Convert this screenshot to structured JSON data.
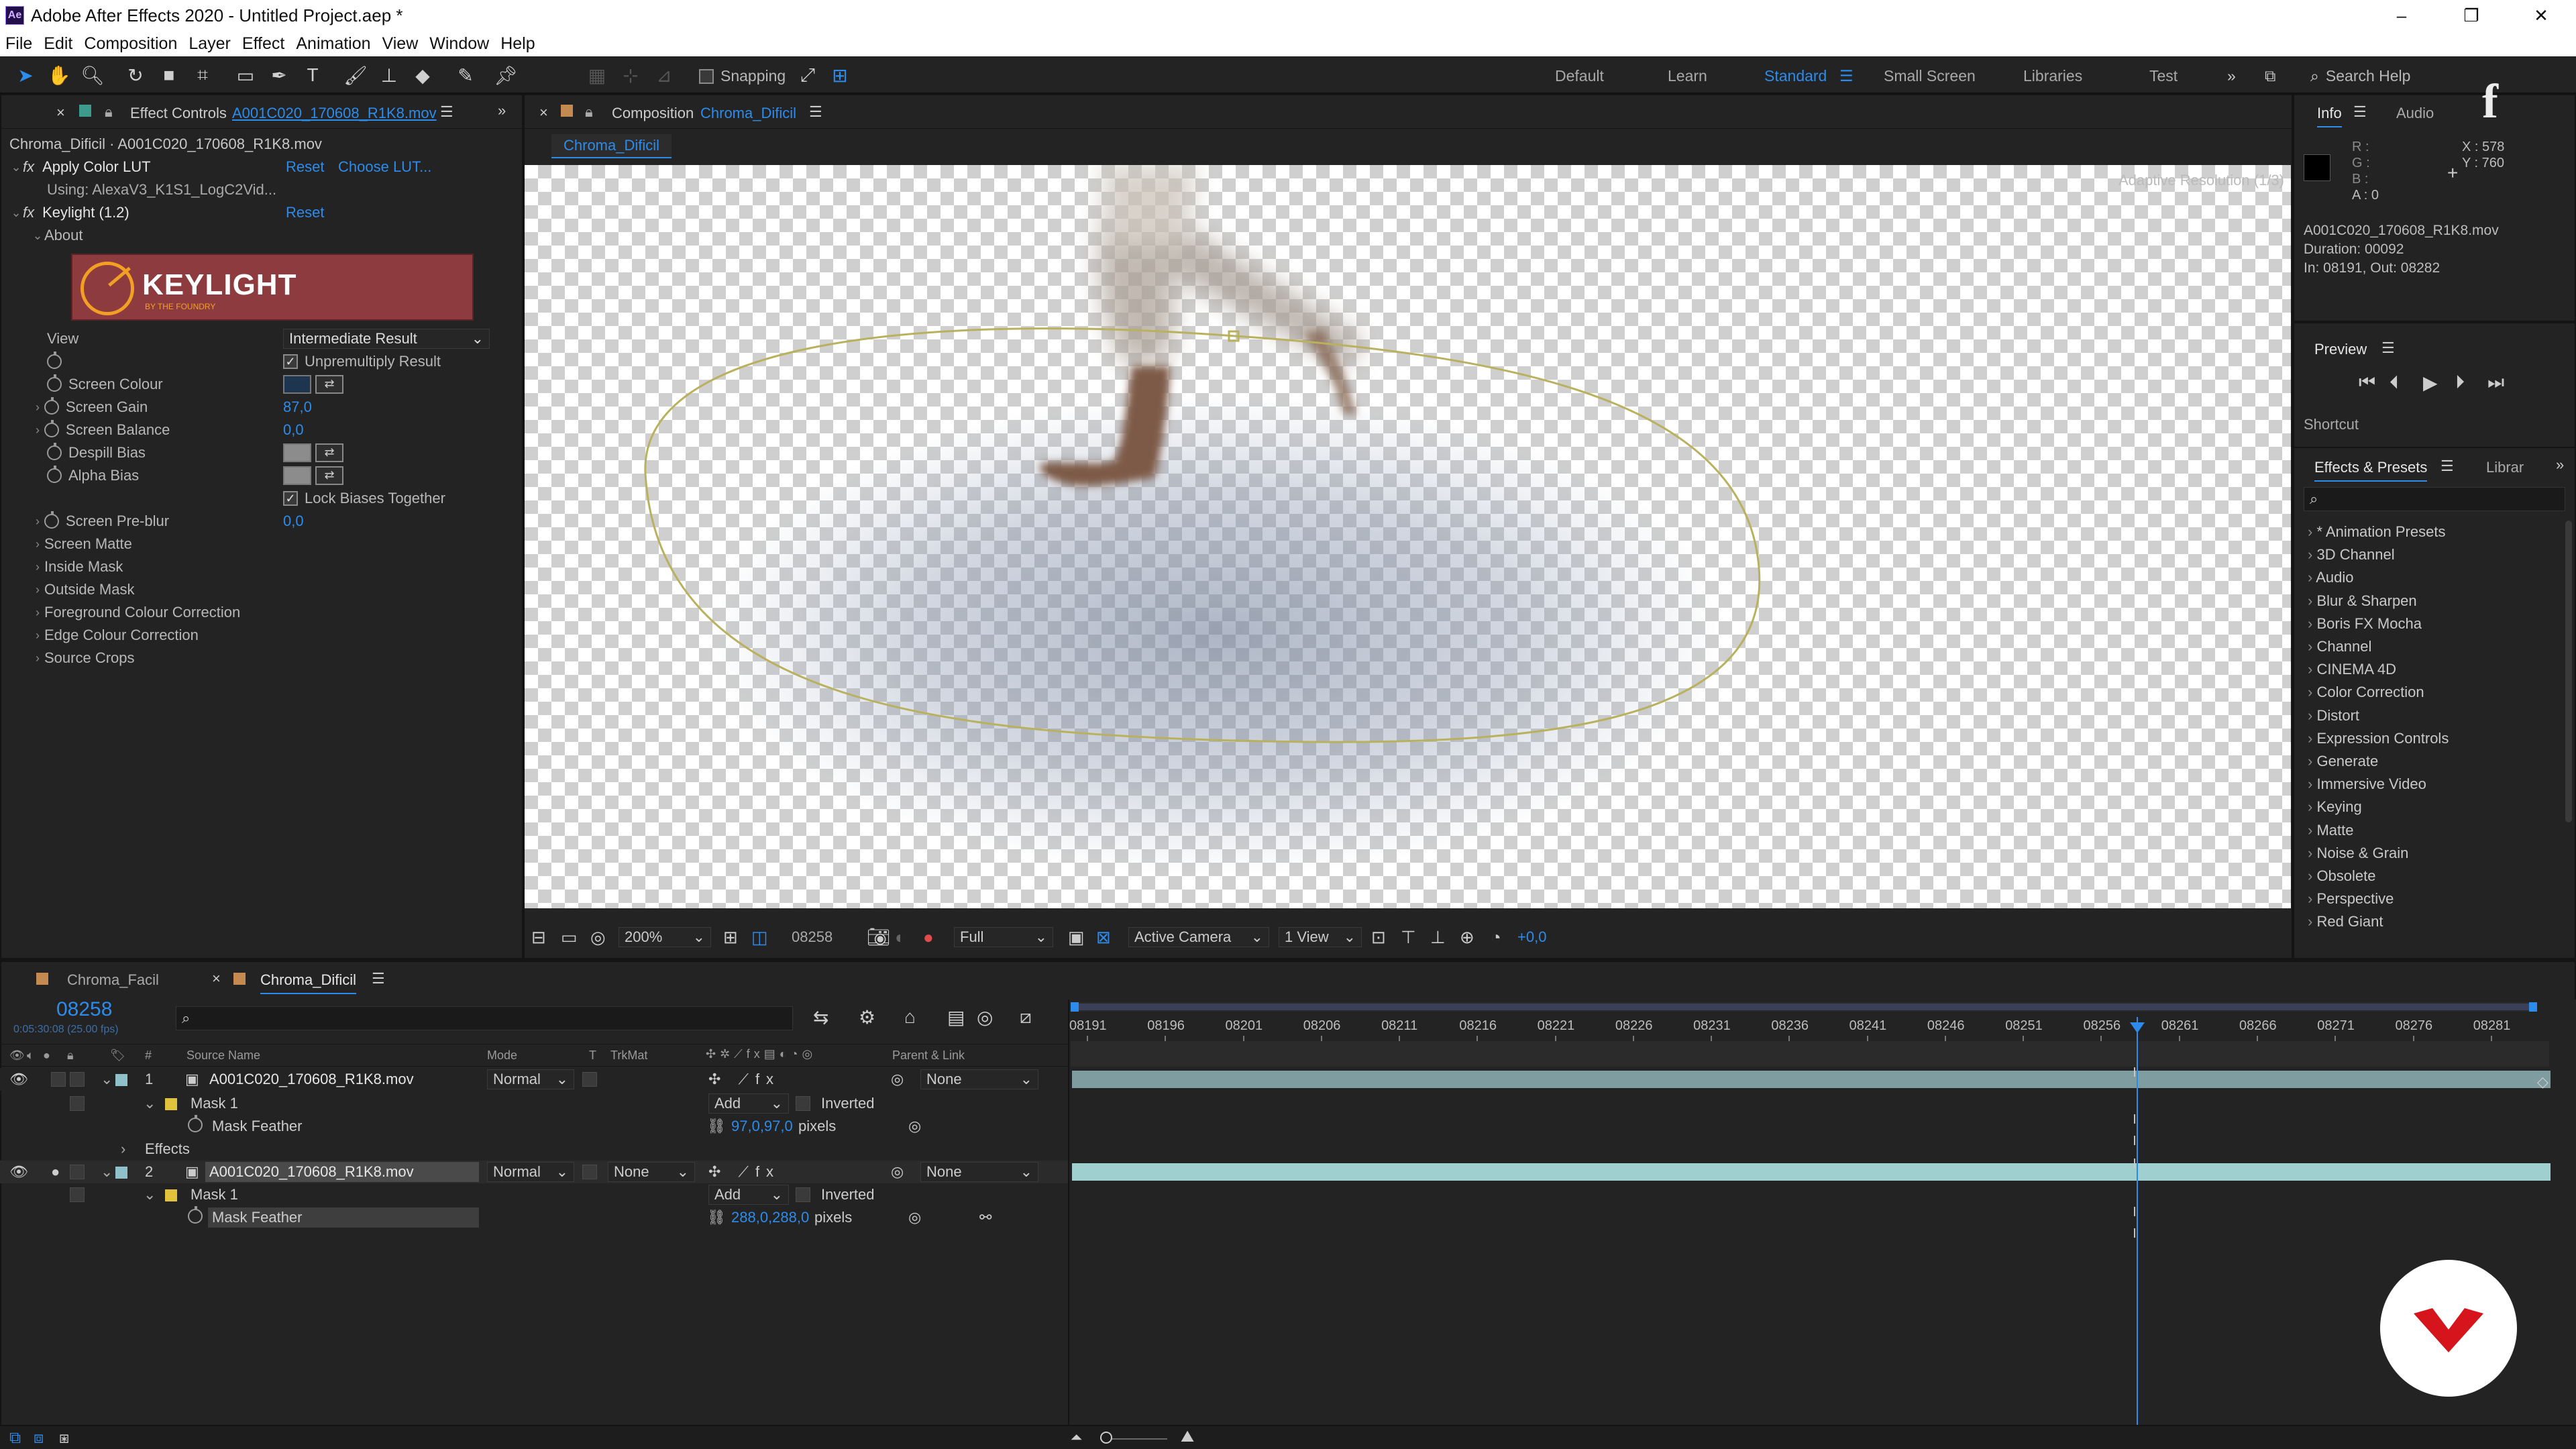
{
  "window": {
    "title": "Adobe After Effects 2020 - Untitled Project.aep *",
    "app_icon": "Ae",
    "controls": [
      "–",
      "❐",
      "✕"
    ]
  },
  "menu": [
    "File",
    "Edit",
    "Composition",
    "Layer",
    "Effect",
    "Animation",
    "View",
    "Window",
    "Help"
  ],
  "toolbar": {
    "snapping_label": "Snapping",
    "workspaces": [
      "Default",
      "Learn",
      "Standard",
      "Small Screen",
      "Libraries",
      "Test"
    ],
    "active_workspace": "Standard",
    "search_placeholder": "Search Help"
  },
  "effect_controls": {
    "tab_prefix": "Effect Controls",
    "tab_file": "A001C020_170608_R1K8.mov",
    "subtitle": "Chroma_Dificil · A001C020_170608_R1K8.mov",
    "apply_lut": {
      "name": "Apply Color LUT",
      "reset": "Reset",
      "choose": "Choose LUT...",
      "using": "Using: AlexaV3_K1S1_LogC2Vid..."
    },
    "keylight": {
      "name": "Keylight (1.2)",
      "reset": "Reset",
      "about": "About",
      "logo_text": "KEYLIGHT",
      "logo_sub": "BY THE FOUNDRY"
    },
    "view_label": "View",
    "view_value": "Intermediate Result",
    "unpremultiply": "Unpremultiply Result",
    "screen_colour": "Screen Colour",
    "screen_gain": {
      "label": "Screen Gain",
      "value": "87,0"
    },
    "screen_balance": {
      "label": "Screen Balance",
      "value": "0,0"
    },
    "despill_bias": "Despill Bias",
    "alpha_bias": "Alpha Bias",
    "lock_biases": "Lock Biases Together",
    "screen_preblur": {
      "label": "Screen Pre-blur",
      "value": "0,0"
    },
    "groups": [
      "Screen Matte",
      "Inside Mask",
      "Outside Mask",
      "Foreground Colour Correction",
      "Edge Colour Correction",
      "Source Crops"
    ],
    "colors": {
      "screen_colour": "#1e3550",
      "bias_swatch": "#8c8c8c"
    }
  },
  "composition": {
    "tab_prefix": "Composition",
    "tab_name": "Chroma_Dificil",
    "breadcrumb": "Chroma_Dificil",
    "resolution_note": "Adaptive Resolution (1/3)"
  },
  "viewer_bar": {
    "zoom": "200%",
    "timecode": "08258",
    "quality": "Full",
    "camera": "Active Camera",
    "views": "1 View",
    "exposure": "+0,0"
  },
  "info": {
    "tabs": [
      "Info",
      "Audio"
    ],
    "r": "R :",
    "g": "G :",
    "b": "B :",
    "a": "A : 0",
    "x": "X : 578",
    "y": "Y : 760",
    "file": "A001C020_170608_R1K8.mov",
    "duration": "Duration: 00092",
    "in_out": "In: 08191, Out: 08282"
  },
  "preview": {
    "title": "Preview",
    "shortcut": "Shortcut"
  },
  "effects_presets": {
    "tabs": [
      "Effects & Presets",
      "Librar"
    ],
    "search_placeholder": "",
    "items": [
      "* Animation Presets",
      "3D Channel",
      "Audio",
      "Blur & Sharpen",
      "Boris FX Mocha",
      "Channel",
      "CINEMA 4D",
      "Color Correction",
      "Distort",
      "Expression Controls",
      "Generate",
      "Immersive Video",
      "Keying",
      "Matte",
      "Noise & Grain",
      "Obsolete",
      "Perspective",
      "Red Giant"
    ]
  },
  "timeline": {
    "tabs": [
      "Chroma_Facil",
      "Chroma_Dificil"
    ],
    "active_tab": "Chroma_Dificil",
    "timecode": "08258",
    "timecode_sub": "0:05:30:08 (25.00 fps)",
    "search_placeholder": "",
    "headers": {
      "hash": "#",
      "source": "Source Name",
      "mode": "Mode",
      "t": "T",
      "trkmat": "TrkMat",
      "parent": "Parent & Link"
    },
    "ruler": [
      "08191",
      "08196",
      "08201",
      "08206",
      "08211",
      "08216",
      "08221",
      "08226",
      "08231",
      "08236",
      "08241",
      "08246",
      "08251",
      "08256",
      "08261",
      "08266",
      "08271",
      "08276",
      "08281"
    ],
    "layers": [
      {
        "num": "1",
        "name": "A001C020_170608_R1K8.mov",
        "mode": "Normal",
        "trkmat": "",
        "parent": "None",
        "mask": "Mask 1",
        "mask_mode": "Add",
        "inverted": "Inverted",
        "feather_label": "Mask Feather",
        "feather_value": "97,0,97,0",
        "units": "pixels",
        "effects": "Effects"
      },
      {
        "num": "2",
        "name": "A001C020_170608_R1K8.mov",
        "mode": "Normal",
        "trkmat": "None",
        "parent": "None",
        "mask": "Mask 1",
        "mask_mode": "Add",
        "inverted": "Inverted",
        "feather_label": "Mask Feather",
        "feather_value": "288,0,288,0",
        "units": "pixels"
      }
    ],
    "playhead_fraction": 0.729
  }
}
